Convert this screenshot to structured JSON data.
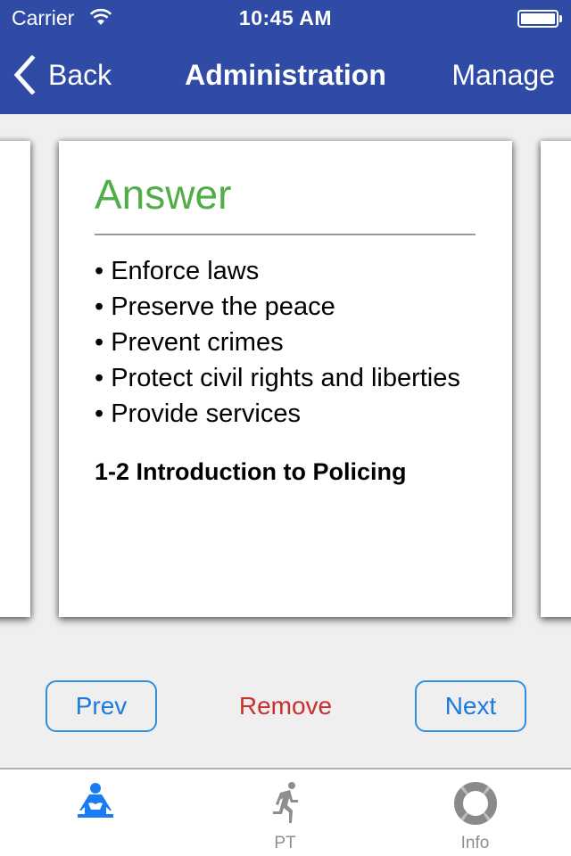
{
  "status_bar": {
    "carrier": "Carrier",
    "time": "10:45 AM"
  },
  "nav": {
    "back_label": "Back",
    "title": "Administration",
    "manage_label": "Manage"
  },
  "card": {
    "heading": "Answer",
    "bullets": [
      "• Enforce laws",
      "• Preserve the peace",
      "• Prevent crimes",
      "• Protect civil rights and liberties",
      "• Provide services"
    ],
    "source": "1-2 Introduction to Policing"
  },
  "actions": {
    "prev_label": "Prev",
    "remove_label": "Remove",
    "next_label": "Next"
  },
  "tabs": [
    {
      "label": "",
      "icon": "study-reader-icon",
      "active": true
    },
    {
      "label": "PT",
      "icon": "running-person-icon",
      "active": false
    },
    {
      "label": "Info",
      "icon": "lifebuoy-icon",
      "active": false
    }
  ],
  "colors": {
    "nav_background": "#2f4ba6",
    "heading_green": "#4fae48",
    "button_blue": "#1c7ae0",
    "remove_red": "#c9302c",
    "tab_active": "#1a7cf5",
    "tab_inactive": "#8e8e8e"
  }
}
